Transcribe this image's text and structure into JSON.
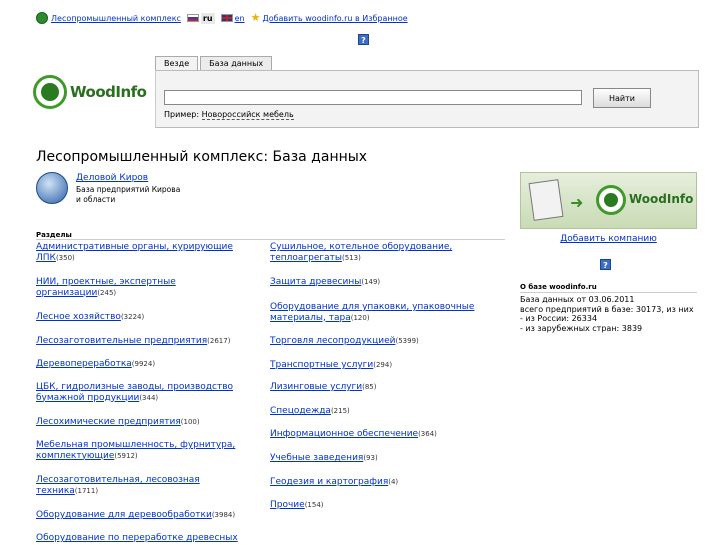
{
  "topbar": {
    "portal_link": "Лесопромышленный комплекс",
    "lang_ru": "ru",
    "lang_en": "en",
    "favorites_link": "Добавить woodinfo.ru в Избранное"
  },
  "help_icon_label": "?",
  "logo_text": "WoodInfo",
  "search": {
    "tabs": [
      "Везде",
      "База данных"
    ],
    "button_label": "Найти",
    "example_prefix": "Пример:",
    "example_query": "Новороссийск мебель",
    "value": ""
  },
  "page_title": "Лесопромышленный комплекс: База данных",
  "kirov": {
    "link": "Деловой Киров",
    "description": "База предприятий Кирова и области"
  },
  "sections_label": "Разделы",
  "sections_left": [
    {
      "title": "Административные органы, курирующие ЛПК",
      "count": "(350)"
    },
    {
      "title": "НИИ, проектные, экспертные организации",
      "count": "(245)"
    },
    {
      "title": "Лесное хозяйство",
      "count": "(3224)"
    },
    {
      "title": "Лесозаготовительные предприятия",
      "count": "(2617)"
    },
    {
      "title": "Деревопереработка",
      "count": "(9924)"
    },
    {
      "title": "ЦБК, гидролизные заводы, производство бумажной продукции",
      "count": "(344)"
    },
    {
      "title": "Лесохимические предприятия",
      "count": "(100)"
    },
    {
      "title": "Мебельная промышленность, фурнитура, комплектующие",
      "count": "(5912)"
    },
    {
      "title": "Лесозаготовительная, лесовозная техника",
      "count": "(1711)"
    },
    {
      "title": "Оборудование для деревообработки",
      "count": "(3984)"
    },
    {
      "title": "Оборудование по переработке древесных",
      "count": ""
    }
  ],
  "sections_right": [
    {
      "title": "Сушильное, котельное оборудование, теплоагрегаты",
      "count": "(513)"
    },
    {
      "title": "Защита древесины",
      "count": "(149)"
    },
    {
      "title": "Оборудование для упаковки, упаковочные материалы, тара",
      "count": "(120)"
    },
    {
      "title": "Торговля лесопродукцией",
      "count": "(5399)"
    },
    {
      "title": "Транспортные услуги",
      "count": "(294)"
    },
    {
      "title": "Лизинговые услуги",
      "count": "(85)"
    },
    {
      "title": "Спецодежда",
      "count": "(215)"
    },
    {
      "title": "Информационное обеспечение",
      "count": "(364)"
    },
    {
      "title": "Учебные заведения",
      "count": "(93)"
    },
    {
      "title": "Геодезия и картография",
      "count": "(4)"
    },
    {
      "title": "Прочие",
      "count": "(154)"
    }
  ],
  "banner_text": "WoodInfo",
  "add_company_link": "Добавить компанию",
  "about": {
    "title": "О базе woodinfo.ru",
    "lines": [
      "База данных от 03.06.2011",
      "всего предприятий в базе: 30173, из них",
      "- из России: 26334",
      "- из зарубежных стран: 3839"
    ]
  },
  "colors": {
    "link": "#0033cc",
    "brand_green": "#2a6e1f",
    "help_blue": "#3b6fc4"
  }
}
